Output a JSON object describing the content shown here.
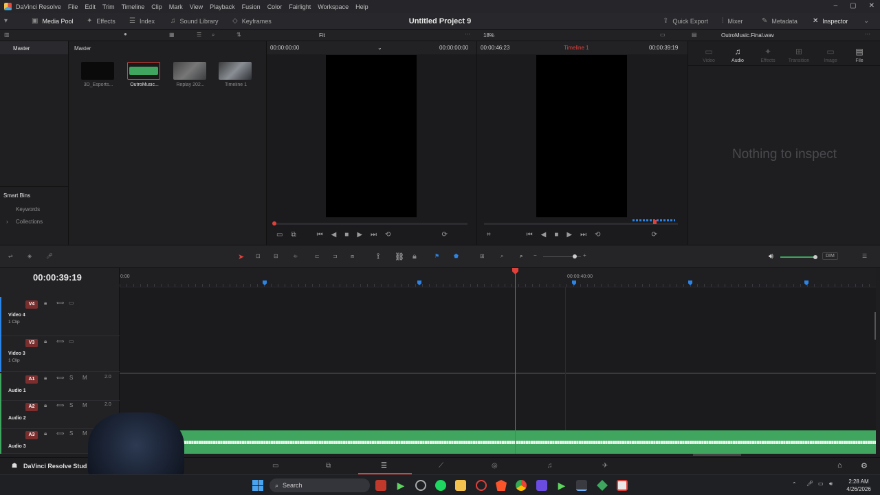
{
  "app": {
    "title": "DaVinci Resolve",
    "project": "Untitled Project 9"
  },
  "menu": [
    "File",
    "Edit",
    "Trim",
    "Timeline",
    "Clip",
    "Mark",
    "View",
    "Playback",
    "Fusion",
    "Color",
    "Fairlight",
    "Workspace",
    "Help"
  ],
  "toolbar": {
    "media_pool": "Media Pool",
    "effects": "Effects",
    "index": "Index",
    "sound_library": "Sound Library",
    "keyframes": "Keyframes",
    "quick_export": "Quick Export",
    "mixer": "Mixer",
    "metadata": "Metadata",
    "inspector": "Inspector"
  },
  "subbar": {
    "fit": "Fit",
    "zoom": "18%",
    "inspected_file": "OutroMusic.Final.wav"
  },
  "mediapool": {
    "bin": "Master",
    "path": "Master",
    "smart_bins": "Smart Bins",
    "keywords": "Keywords",
    "collections": "Collections",
    "clips": [
      {
        "name": "3D_Esports...",
        "thumb": "#0a0a0a"
      },
      {
        "name": "OutroMusic...",
        "thumb": "#3a9c5a"
      },
      {
        "name": "Replay 202...",
        "thumb": "#555a5e"
      },
      {
        "name": "Timeline 1",
        "thumb": "#4d5258"
      }
    ]
  },
  "source_viewer": {
    "tc_left": "00:00:00:00",
    "tc_right": "00:00:00:00"
  },
  "timeline_viewer": {
    "tc_left": "00:00:46:23",
    "name": "Timeline 1",
    "tc_right": "00:00:39:19"
  },
  "inspector": {
    "tabs": [
      "Video",
      "Audio",
      "Effects",
      "Transition",
      "Image",
      "File"
    ],
    "empty": "Nothing to inspect"
  },
  "timeline": {
    "timecode": "00:00:39:19",
    "ruler_start": "0:00",
    "ruler_mark": "00:00:40:00",
    "playhead_fraction": 0.523,
    "dim": "DIM",
    "tracks": [
      {
        "tag": "V4",
        "name": "Video 4",
        "count": "1 Clip",
        "color": "#7a2e2e"
      },
      {
        "tag": "V3",
        "name": "Video 3",
        "count": "1 Clip",
        "color": "#7a2e2e"
      },
      {
        "tag": "A1",
        "name": "Audio 1",
        "level": "2.0",
        "color": "#7a2e2e"
      },
      {
        "tag": "A2",
        "name": "Audio 2",
        "level": "2.0",
        "color": "#7a2e2e"
      },
      {
        "tag": "A3",
        "name": "Audio 3",
        "level": "",
        "color": "#7a2e2e"
      }
    ]
  },
  "pages": {
    "active": "Edit",
    "brand": "DaVinci Resolve Stud"
  },
  "taskbar": {
    "search": "Search",
    "time": "2:28 AM",
    "date": "4/26/2026"
  },
  "colors": {
    "accent_red": "#e0403a",
    "marker_blue": "#2b84e6",
    "audio_green": "#3fa55f",
    "playhead": "#e0403a"
  }
}
